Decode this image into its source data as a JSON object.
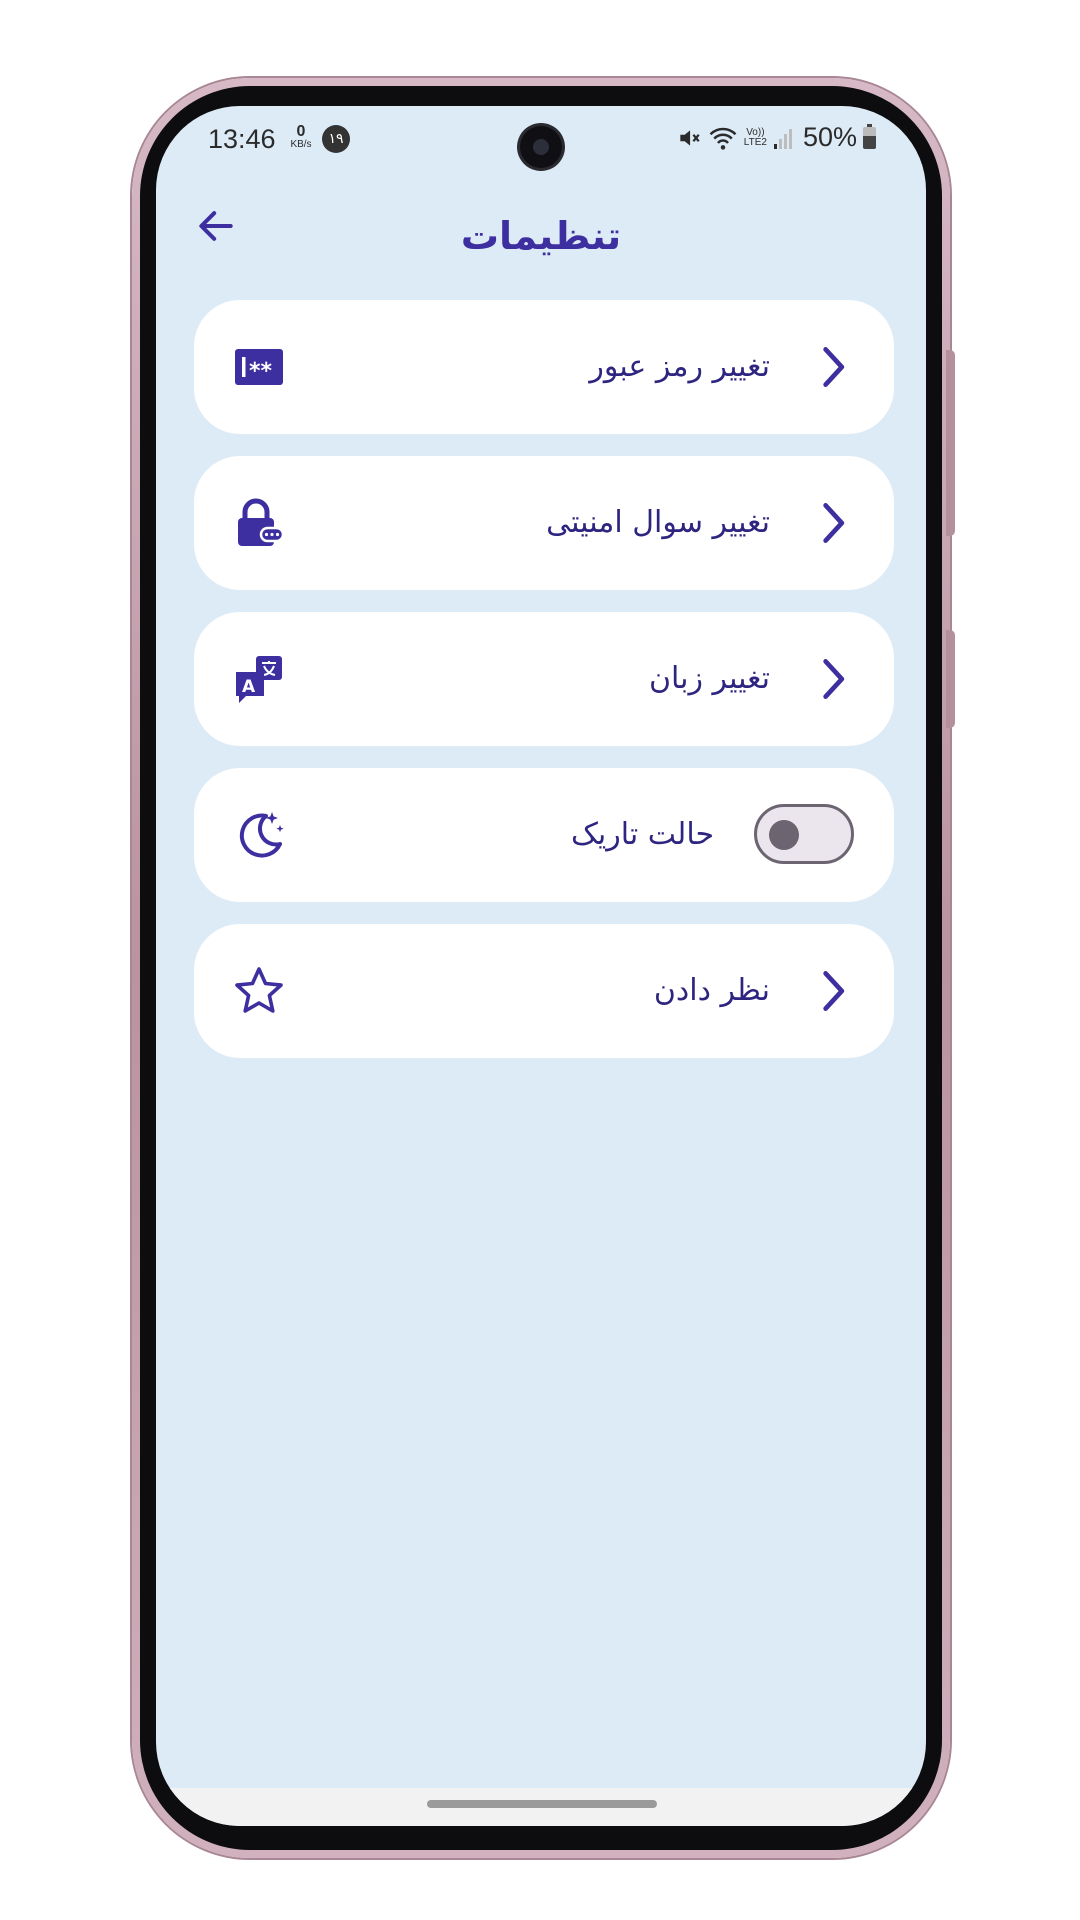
{
  "status_bar": {
    "time": "13:46",
    "net_speed_value": "0",
    "net_speed_unit": "KB/s",
    "notification_count": "۱۹",
    "volte_top": "Vo))",
    "volte_bottom": "LTE2",
    "battery_percent": "50%"
  },
  "header": {
    "title": "تنظیمات",
    "back_icon": "arrow-left-icon"
  },
  "settings": {
    "items": [
      {
        "label": "تغییر رمز عبور",
        "icon": "password-icon",
        "control": "chevron"
      },
      {
        "label": "تغییر سوال امنیتی",
        "icon": "lock-icon",
        "control": "chevron"
      },
      {
        "label": "تغییر زبان",
        "icon": "translate-icon",
        "control": "chevron"
      },
      {
        "label": "حالت تاریک",
        "icon": "moon-icon",
        "control": "toggle",
        "toggle_on": false
      },
      {
        "label": "نظر دادن",
        "icon": "star-icon",
        "control": "chevron"
      }
    ]
  },
  "colors": {
    "background": "#ddebf7",
    "card": "#ffffff",
    "accent": "#3e2fa0",
    "text": "#2e2580"
  }
}
